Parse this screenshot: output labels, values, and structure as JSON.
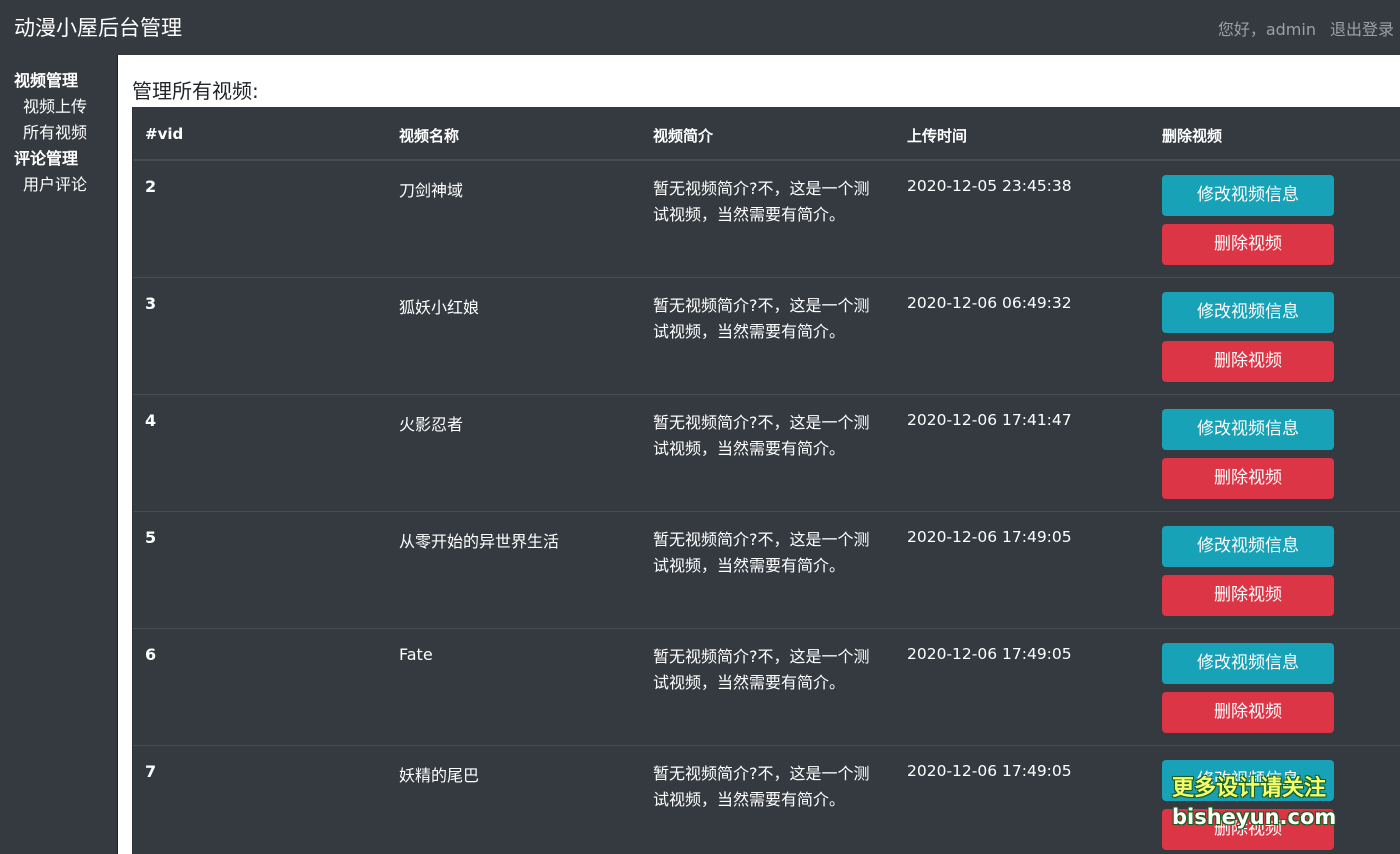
{
  "header": {
    "brand": "动漫小屋后台管理",
    "greeting": "您好，admin",
    "logout": "退出登录"
  },
  "sidebar": {
    "groups": [
      {
        "label": "视频管理",
        "items": [
          {
            "label": "视频上传"
          },
          {
            "label": "所有视频"
          }
        ]
      },
      {
        "label": "评论管理",
        "items": [
          {
            "label": "用户评论"
          }
        ]
      }
    ]
  },
  "main": {
    "title": "管理所有视频:",
    "table": {
      "columns": [
        "#vid",
        "视频名称",
        "视频简介",
        "上传时间",
        "删除视频"
      ],
      "edit_label": "修改视频信息",
      "delete_label": "删除视频",
      "rows": [
        {
          "vid": "2",
          "name": "刀剑神域",
          "intro": "暂无视频简介?不，这是一个测试视频，当然需要有简介。",
          "time": "2020-12-05 23:45:38"
        },
        {
          "vid": "3",
          "name": "狐妖小红娘",
          "intro": "暂无视频简介?不，这是一个测试视频，当然需要有简介。",
          "time": "2020-12-06 06:49:32"
        },
        {
          "vid": "4",
          "name": "火影忍者",
          "intro": "暂无视频简介?不，这是一个测试视频，当然需要有简介。",
          "time": "2020-12-06 17:41:47"
        },
        {
          "vid": "5",
          "name": "从零开始的异世界生活",
          "intro": "暂无视频简介?不，这是一个测试视频，当然需要有简介。",
          "time": "2020-12-06 17:49:05"
        },
        {
          "vid": "6",
          "name": "Fate",
          "intro": "暂无视频简介?不，这是一个测试视频，当然需要有简介。",
          "time": "2020-12-06 17:49:05"
        },
        {
          "vid": "7",
          "name": "妖精的尾巴",
          "intro": "暂无视频简介?不，这是一个测试视频，当然需要有简介。",
          "time": "2020-12-06 17:49:05"
        }
      ]
    }
  },
  "watermark": {
    "line1": "更多设计请关注",
    "line2": "bisheyun.com"
  },
  "colors": {
    "dark_bg": "#343a40",
    "edit_button": "#17a2b8",
    "delete_button": "#dc3545"
  }
}
